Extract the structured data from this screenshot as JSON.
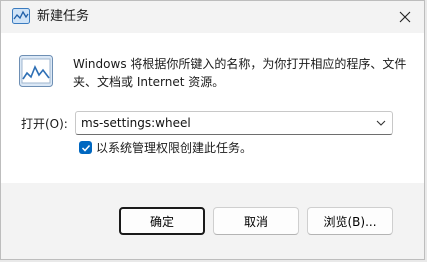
{
  "window": {
    "title": "新建任务",
    "description": "Windows 将根据你所键入的名称，为你打开相应的程序、文件夹、文档或 Internet 资源。"
  },
  "open_field": {
    "label": "打开(O):",
    "value": "ms-settings:wheel"
  },
  "admin_option": {
    "label": "以系统管理权限创建此任务。",
    "checked": true
  },
  "buttons": {
    "ok": "确定",
    "cancel": "取消",
    "browse": "浏览(B)..."
  },
  "colors": {
    "accent": "#0067c0"
  },
  "icons": [
    "task-manager-icon",
    "close-icon",
    "run-program-icon",
    "chevron-down-icon",
    "checkmark-icon"
  ]
}
